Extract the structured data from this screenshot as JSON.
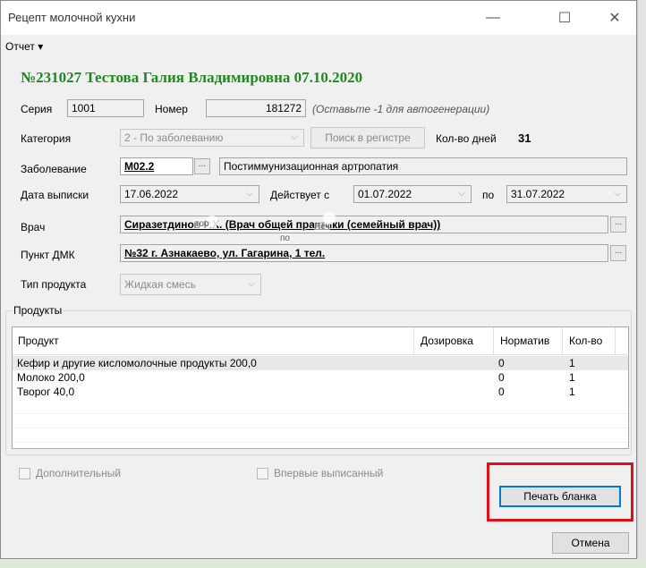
{
  "window": {
    "title": "Рецепт молочной кухни",
    "minimize_glyph": "—",
    "maximize_glyph": "☐",
    "close_glyph": "✕"
  },
  "menu": {
    "report": "Отчет ▾"
  },
  "heading": "№231027 Тестова Галия Владимировна 07.10.2020",
  "fields": {
    "series_label": "Серия",
    "series_value": "1001",
    "number_label": "Номер",
    "number_value": "181272",
    "number_hint": "(Оставьте -1 для автогенерации)",
    "category_label": "Категория",
    "category_value": "2 - По заболеванию",
    "registry_button": "Поиск в регистре",
    "days_label": "Кол-во дней",
    "days_value": "31",
    "disease_label": "Заболевание",
    "disease_code": "M02.2",
    "disease_name": "Постиммунизационная артропатия",
    "issue_date_label": "Дата выписки",
    "issue_date": "17.06.2022",
    "valid_from_label": "Действует с",
    "valid_from": "01.07.2022",
    "valid_to_label": "по",
    "valid_to": "31.07.2022",
    "doctor_label": "Врач",
    "doctor_value": "Сиразетдинов Р.Х. (Врач общей практики (семейный врач))",
    "dmk_label": "Пункт ДМК",
    "dmk_value": "№32 г. Азнакаево, ул. Гагарина, 1 тел.",
    "product_type_label": "Тип продукта",
    "product_type_value": "Жидкая смесь",
    "pick_glyph": "..."
  },
  "overlay": {
    "text_1": "тоо",
    "text_2": "Печ",
    "text_3": "по"
  },
  "products": {
    "group_title": "Продукты",
    "columns": [
      "Продукт",
      "Дозировка",
      "Норматив",
      "Кол-во"
    ],
    "rows": [
      {
        "product": "Кефир и другие кисломолочные продукты 200,0",
        "dosage": "",
        "norm": "0",
        "qty": "1"
      },
      {
        "product": "Молоко 200,0",
        "dosage": "",
        "norm": "0",
        "qty": "1"
      },
      {
        "product": "Творог 40,0",
        "dosage": "",
        "norm": "0",
        "qty": "1"
      }
    ]
  },
  "checkboxes": {
    "additional": "Дополнительный",
    "first_time": "Впервые выписанный"
  },
  "buttons": {
    "print": "Печать бланка",
    "cancel": "Отмена"
  }
}
